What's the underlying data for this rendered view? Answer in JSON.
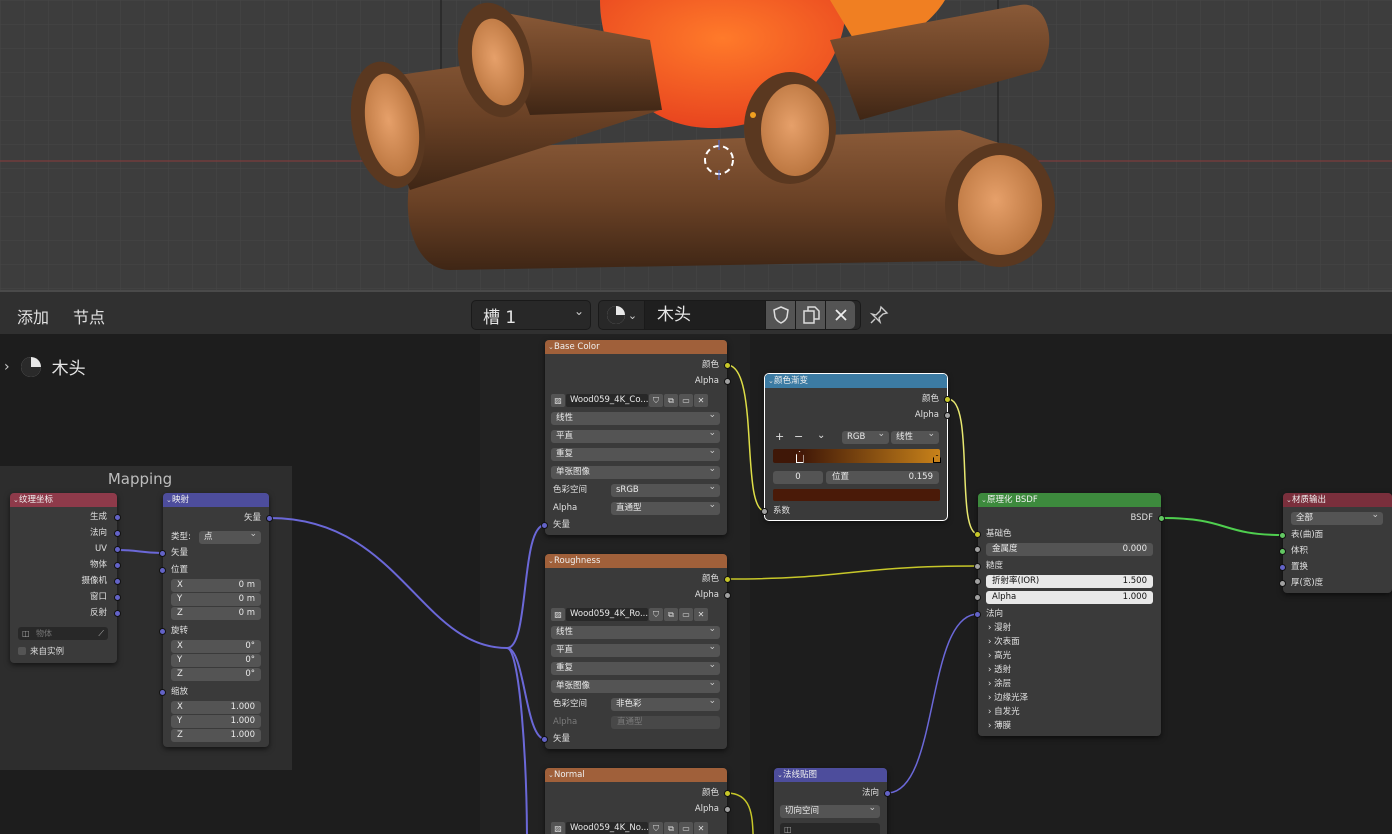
{
  "toolbar": {
    "add": "添加",
    "node": "节点",
    "slot": "槽 1",
    "material_name": "木头"
  },
  "breadcrumb": {
    "material": "木头"
  },
  "frame": {
    "label": "Mapping"
  },
  "tex_coord": {
    "title": "纹理坐标",
    "outputs": [
      "生成",
      "法向",
      "UV",
      "物体",
      "摄像机",
      "窗口",
      "反射"
    ],
    "object_placeholder": "物体",
    "from_instancer": "来自实例"
  },
  "mapping": {
    "title": "映射",
    "out_vector": "矢量",
    "type_label": "类型:",
    "type_value": "点",
    "in_vector": "矢量",
    "location": "位置",
    "rotation": "旋转",
    "scale": "缩放",
    "loc": [
      {
        "a": "X",
        "v": "0 m"
      },
      {
        "a": "Y",
        "v": "0 m"
      },
      {
        "a": "Z",
        "v": "0 m"
      }
    ],
    "rot": [
      {
        "a": "X",
        "v": "0°"
      },
      {
        "a": "Y",
        "v": "0°"
      },
      {
        "a": "Z",
        "v": "0°"
      }
    ],
    "scl": [
      {
        "a": "X",
        "v": "1.000"
      },
      {
        "a": "Y",
        "v": "1.000"
      },
      {
        "a": "Z",
        "v": "1.000"
      }
    ]
  },
  "base_color": {
    "title": "Base Color",
    "out_color": "颜色",
    "out_alpha": "Alpha",
    "image": "Wood059_4K_Co...",
    "interp": "线性",
    "proj": "平直",
    "ext": "重复",
    "source": "单张图像",
    "cs_label": "色彩空间",
    "cs_value": "sRGB",
    "alpha_label": "Alpha",
    "alpha_value": "直通型",
    "in_vector": "矢量"
  },
  "roughness": {
    "title": "Roughness",
    "out_color": "颜色",
    "out_alpha": "Alpha",
    "image": "Wood059_4K_Ro...",
    "interp": "线性",
    "proj": "平直",
    "ext": "重复",
    "source": "单张图像",
    "cs_label": "色彩空间",
    "cs_value": "非色彩",
    "alpha_label": "Alpha",
    "alpha_value": "直通型",
    "in_vector": "矢量"
  },
  "normal_tex": {
    "title": "Normal",
    "out_color": "颜色",
    "out_alpha": "Alpha",
    "image": "Wood059_4K_No..."
  },
  "color_ramp": {
    "title": "颜色渐变",
    "out_color": "颜色",
    "out_alpha": "Alpha",
    "add": "+",
    "remove": "−",
    "menu": "⌄",
    "mode": "RGB",
    "interp": "线性",
    "index": "0",
    "pos_label": "位置",
    "pos_value": "0.159",
    "in_fac": "系数",
    "stop_position": 0.159,
    "colors": {
      "ramp_start": "#3f1707",
      "ramp_end": "#c8821a",
      "stop": "#4a1a08"
    }
  },
  "bsdf": {
    "title": "原理化 BSDF",
    "out": "BSDF",
    "base_color": "基础色",
    "metallic_label": "金属度",
    "metallic": "0.000",
    "roughness": "糙度",
    "ior_label": "折射率(IOR)",
    "ior": "1.500",
    "alpha_label": "Alpha",
    "alpha": "1.000",
    "normal": "法向",
    "panels": [
      "漫射",
      "次表面",
      "高光",
      "透射",
      "涂层",
      "边缘光泽",
      "自发光",
      "薄膜"
    ]
  },
  "normal_map": {
    "title": "法线贴图",
    "out": "法向",
    "space": "切向空间"
  },
  "output": {
    "title": "材质输出",
    "target": "全部",
    "inputs": [
      "表(曲)面",
      "体积",
      "置换",
      "厚(宽)度"
    ]
  },
  "colors": {
    "header_input": "#8e3a4a",
    "header_vector": "#4d4d9c",
    "header_texture": "#a0603a",
    "header_converter": "#3c7ba3",
    "header_shader": "#3d8a3d",
    "header_output": "#7a2f3c",
    "socket_vector": "#6363c7",
    "socket_color": "#c7c729",
    "socket_float": "#a1a1a1",
    "socket_shader": "#63c763",
    "link_vector": "#6b68d8",
    "link_color": "#dede47",
    "link_float": "#a1a1a1",
    "link_shader": "#4fcf4f"
  }
}
